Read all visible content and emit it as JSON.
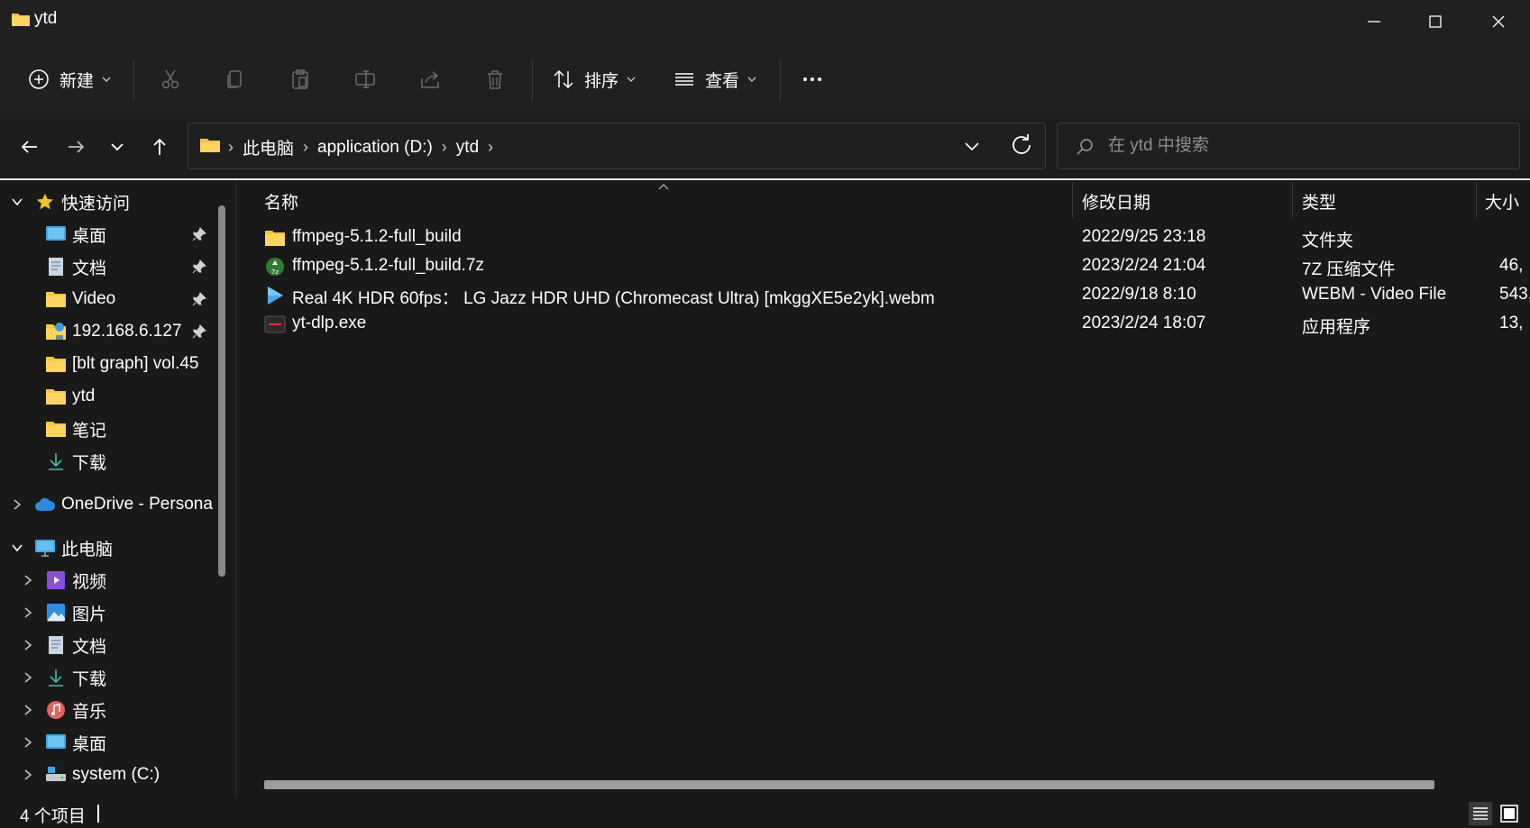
{
  "window": {
    "title": "ytd",
    "minimize_icon": "minimize-icon",
    "maximize_icon": "maximize-icon",
    "close_icon": "close-icon"
  },
  "toolbar": {
    "new_label": "新建",
    "sort_label": "排序",
    "view_label": "查看",
    "more_icon": "ellipsis-icon"
  },
  "address": {
    "crumbs": [
      "此电脑",
      "application (D:)",
      "ytd"
    ],
    "search_placeholder": "在 ytd 中搜索"
  },
  "sidebar": {
    "quick_access": "快速访问",
    "quick_items": [
      {
        "label": "桌面",
        "icon": "desktop-icon",
        "pinned": true
      },
      {
        "label": "文档",
        "icon": "documents-icon",
        "pinned": true
      },
      {
        "label": "Video",
        "icon": "folder-icon",
        "pinned": true
      },
      {
        "label": "192.168.6.127",
        "icon": "network-folder-icon",
        "pinned": true
      },
      {
        "label": "[blt graph] vol.45",
        "icon": "folder-icon",
        "pinned": false
      },
      {
        "label": "ytd",
        "icon": "folder-icon",
        "pinned": false
      },
      {
        "label": "笔记",
        "icon": "folder-icon",
        "pinned": false
      },
      {
        "label": "下载",
        "icon": "download-icon",
        "pinned": false
      }
    ],
    "onedrive": "OneDrive - Persona",
    "this_pc": "此电脑",
    "pc_items": [
      {
        "label": "视频",
        "icon": "videos-icon"
      },
      {
        "label": "图片",
        "icon": "pictures-icon"
      },
      {
        "label": "文档",
        "icon": "documents-icon"
      },
      {
        "label": "下载",
        "icon": "download-icon"
      },
      {
        "label": "音乐",
        "icon": "music-icon"
      },
      {
        "label": "桌面",
        "icon": "desktop-icon"
      },
      {
        "label": "system (C:)",
        "icon": "drive-icon"
      }
    ]
  },
  "columns": {
    "name": "名称",
    "date": "修改日期",
    "type": "类型",
    "size": "大小"
  },
  "files": [
    {
      "name": "ffmpeg-5.1.2-full_build",
      "date": "2022/9/25 23:18",
      "type": "文件夹",
      "size": "",
      "icon": "folder-icon"
    },
    {
      "name": "ffmpeg-5.1.2-full_build.7z",
      "date": "2023/2/24 21:04",
      "type": "7Z 压缩文件",
      "size": "46,",
      "icon": "archive-7z-icon"
    },
    {
      "name": "Real 4K HDR 60fps：  LG Jazz HDR UHD (Chromecast Ultra) [mkggXE5e2yk].webm",
      "date": "2022/9/18 8:10",
      "type": "WEBM - Video File",
      "size": "543,",
      "icon": "video-play-icon"
    },
    {
      "name": "yt-dlp.exe",
      "date": "2023/2/24 18:07",
      "type": "应用程序",
      "size": "13,",
      "icon": "exe-icon"
    }
  ],
  "status": {
    "count": "4 个项目"
  },
  "colors": {
    "folder": "#f4c542",
    "accent": "#4cc2ff",
    "background": "#191919",
    "bar": "#202020"
  }
}
